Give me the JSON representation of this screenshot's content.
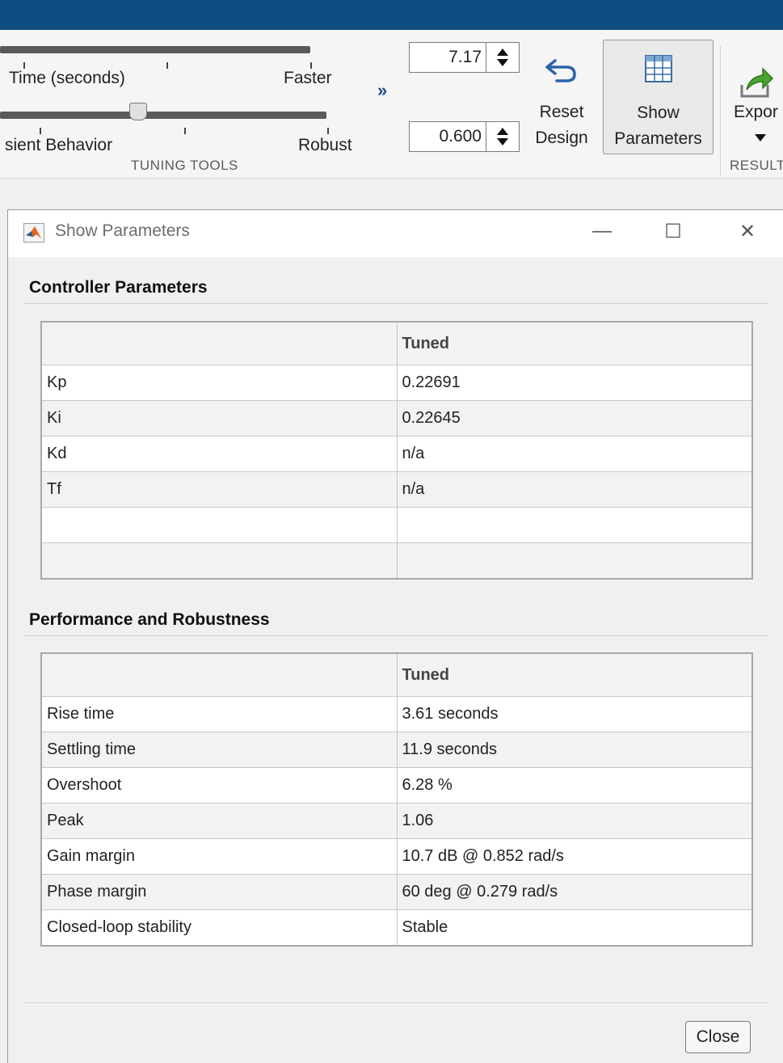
{
  "ribbon": {
    "slider1": {
      "left_label": "Time (seconds)",
      "right_label": "Faster"
    },
    "slider2": {
      "left_label": "sient Behavior",
      "right_label": "Robust"
    },
    "section_label": "TUNING TOOLS",
    "response_time": {
      "value": "7.17"
    },
    "transient_behavior": {
      "value": "0.600"
    },
    "reset_design": {
      "line1": "Reset",
      "line2": "Design"
    },
    "show_parameters": {
      "line1": "Show",
      "line2": "Parameters"
    },
    "export": {
      "label": "Expor"
    },
    "results_label": "RESULT"
  },
  "dialog": {
    "title": "Show Parameters",
    "controller": {
      "heading": "Controller Parameters",
      "column_header": "Tuned",
      "rows": [
        {
          "name": "Kp",
          "value": "0.22691"
        },
        {
          "name": "Ki",
          "value": "0.22645"
        },
        {
          "name": "Kd",
          "value": "n/a"
        },
        {
          "name": "Tf",
          "value": "n/a"
        },
        {
          "name": "",
          "value": ""
        },
        {
          "name": "",
          "value": ""
        }
      ]
    },
    "performance": {
      "heading": "Performance and Robustness",
      "column_header": "Tuned",
      "rows": [
        {
          "name": "Rise time",
          "value": "3.61 seconds"
        },
        {
          "name": "Settling time",
          "value": "11.9 seconds"
        },
        {
          "name": "Overshoot",
          "value": "6.28 %"
        },
        {
          "name": "Peak",
          "value": "1.06"
        },
        {
          "name": "Gain margin",
          "value": "10.7 dB @ 0.852 rad/s"
        },
        {
          "name": "Phase margin",
          "value": "60 deg @ 0.279 rad/s"
        },
        {
          "name": "Closed-loop stability",
          "value": "Stable"
        }
      ]
    },
    "close_label": "Close"
  }
}
